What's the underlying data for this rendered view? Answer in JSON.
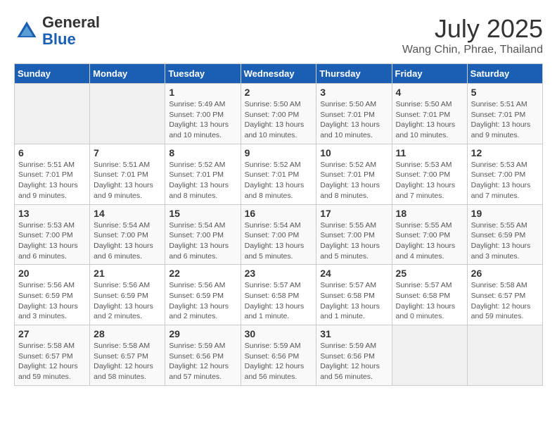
{
  "header": {
    "logo_general": "General",
    "logo_blue": "Blue",
    "month": "July 2025",
    "location": "Wang Chin, Phrae, Thailand"
  },
  "weekdays": [
    "Sunday",
    "Monday",
    "Tuesday",
    "Wednesday",
    "Thursday",
    "Friday",
    "Saturday"
  ],
  "weeks": [
    [
      {
        "day": "",
        "info": ""
      },
      {
        "day": "",
        "info": ""
      },
      {
        "day": "1",
        "info": "Sunrise: 5:49 AM\nSunset: 7:00 PM\nDaylight: 13 hours\nand 10 minutes."
      },
      {
        "day": "2",
        "info": "Sunrise: 5:50 AM\nSunset: 7:00 PM\nDaylight: 13 hours\nand 10 minutes."
      },
      {
        "day": "3",
        "info": "Sunrise: 5:50 AM\nSunset: 7:01 PM\nDaylight: 13 hours\nand 10 minutes."
      },
      {
        "day": "4",
        "info": "Sunrise: 5:50 AM\nSunset: 7:01 PM\nDaylight: 13 hours\nand 10 minutes."
      },
      {
        "day": "5",
        "info": "Sunrise: 5:51 AM\nSunset: 7:01 PM\nDaylight: 13 hours\nand 9 minutes."
      }
    ],
    [
      {
        "day": "6",
        "info": "Sunrise: 5:51 AM\nSunset: 7:01 PM\nDaylight: 13 hours\nand 9 minutes."
      },
      {
        "day": "7",
        "info": "Sunrise: 5:51 AM\nSunset: 7:01 PM\nDaylight: 13 hours\nand 9 minutes."
      },
      {
        "day": "8",
        "info": "Sunrise: 5:52 AM\nSunset: 7:01 PM\nDaylight: 13 hours\nand 8 minutes."
      },
      {
        "day": "9",
        "info": "Sunrise: 5:52 AM\nSunset: 7:01 PM\nDaylight: 13 hours\nand 8 minutes."
      },
      {
        "day": "10",
        "info": "Sunrise: 5:52 AM\nSunset: 7:01 PM\nDaylight: 13 hours\nand 8 minutes."
      },
      {
        "day": "11",
        "info": "Sunrise: 5:53 AM\nSunset: 7:00 PM\nDaylight: 13 hours\nand 7 minutes."
      },
      {
        "day": "12",
        "info": "Sunrise: 5:53 AM\nSunset: 7:00 PM\nDaylight: 13 hours\nand 7 minutes."
      }
    ],
    [
      {
        "day": "13",
        "info": "Sunrise: 5:53 AM\nSunset: 7:00 PM\nDaylight: 13 hours\nand 6 minutes."
      },
      {
        "day": "14",
        "info": "Sunrise: 5:54 AM\nSunset: 7:00 PM\nDaylight: 13 hours\nand 6 minutes."
      },
      {
        "day": "15",
        "info": "Sunrise: 5:54 AM\nSunset: 7:00 PM\nDaylight: 13 hours\nand 6 minutes."
      },
      {
        "day": "16",
        "info": "Sunrise: 5:54 AM\nSunset: 7:00 PM\nDaylight: 13 hours\nand 5 minutes."
      },
      {
        "day": "17",
        "info": "Sunrise: 5:55 AM\nSunset: 7:00 PM\nDaylight: 13 hours\nand 5 minutes."
      },
      {
        "day": "18",
        "info": "Sunrise: 5:55 AM\nSunset: 7:00 PM\nDaylight: 13 hours\nand 4 minutes."
      },
      {
        "day": "19",
        "info": "Sunrise: 5:55 AM\nSunset: 6:59 PM\nDaylight: 13 hours\nand 3 minutes."
      }
    ],
    [
      {
        "day": "20",
        "info": "Sunrise: 5:56 AM\nSunset: 6:59 PM\nDaylight: 13 hours\nand 3 minutes."
      },
      {
        "day": "21",
        "info": "Sunrise: 5:56 AM\nSunset: 6:59 PM\nDaylight: 13 hours\nand 2 minutes."
      },
      {
        "day": "22",
        "info": "Sunrise: 5:56 AM\nSunset: 6:59 PM\nDaylight: 13 hours\nand 2 minutes."
      },
      {
        "day": "23",
        "info": "Sunrise: 5:57 AM\nSunset: 6:58 PM\nDaylight: 13 hours\nand 1 minute."
      },
      {
        "day": "24",
        "info": "Sunrise: 5:57 AM\nSunset: 6:58 PM\nDaylight: 13 hours\nand 1 minute."
      },
      {
        "day": "25",
        "info": "Sunrise: 5:57 AM\nSunset: 6:58 PM\nDaylight: 13 hours\nand 0 minutes."
      },
      {
        "day": "26",
        "info": "Sunrise: 5:58 AM\nSunset: 6:57 PM\nDaylight: 12 hours\nand 59 minutes."
      }
    ],
    [
      {
        "day": "27",
        "info": "Sunrise: 5:58 AM\nSunset: 6:57 PM\nDaylight: 12 hours\nand 59 minutes."
      },
      {
        "day": "28",
        "info": "Sunrise: 5:58 AM\nSunset: 6:57 PM\nDaylight: 12 hours\nand 58 minutes."
      },
      {
        "day": "29",
        "info": "Sunrise: 5:59 AM\nSunset: 6:56 PM\nDaylight: 12 hours\nand 57 minutes."
      },
      {
        "day": "30",
        "info": "Sunrise: 5:59 AM\nSunset: 6:56 PM\nDaylight: 12 hours\nand 56 minutes."
      },
      {
        "day": "31",
        "info": "Sunrise: 5:59 AM\nSunset: 6:56 PM\nDaylight: 12 hours\nand 56 minutes."
      },
      {
        "day": "",
        "info": ""
      },
      {
        "day": "",
        "info": ""
      }
    ]
  ]
}
